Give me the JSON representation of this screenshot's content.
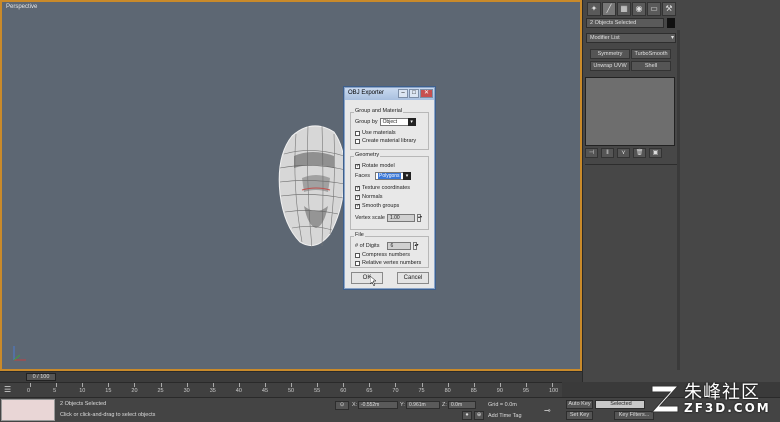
{
  "viewport": {
    "label": "Perspective"
  },
  "dialog": {
    "title": "OBJ Exporter",
    "group_material": {
      "title": "Group and Material",
      "group_by_label": "Group by",
      "group_by_value": "Object",
      "use_materials": "Use materials",
      "create_library": "Create material library"
    },
    "geometry": {
      "title": "Geometry",
      "flip_yz": "Rotate model",
      "faces_label": "Faces",
      "faces_value": "Polygons",
      "texture_coords": "Texture coordinates",
      "normals": "Normals",
      "smooth_groups": "Smooth groups",
      "vertex_scale_label": "Vertex scale",
      "vertex_scale_value": "1.00"
    },
    "file": {
      "title": "File",
      "digits_label": "# of Digits",
      "digits_value": "6",
      "compress": "Compress numbers",
      "relative": "Relative vertex numbers"
    },
    "ok": "OK",
    "cancel": "Cancel"
  },
  "command_panel": {
    "selection": "2 Objects Selected",
    "modifier_list": "Modifier List",
    "buttons": [
      "Symmetry",
      "TurboSmooth",
      "Unwrap UVW",
      "Shell"
    ]
  },
  "timeline": {
    "frame": "0 / 100",
    "ticks": [
      "0",
      "5",
      "10",
      "15",
      "20",
      "25",
      "30",
      "35",
      "40",
      "45",
      "50",
      "55",
      "60",
      "65",
      "70",
      "75",
      "80",
      "85",
      "90",
      "95",
      "100"
    ]
  },
  "status": {
    "selected": "2 Objects Selected",
    "prompt": "Click or click-and-drag to select objects",
    "x": "-0.552m",
    "y": "0.961m",
    "z": "0.0m",
    "grid": "Grid = 0.0m",
    "add_time_tag": "Add Time Tag",
    "auto_key": "Auto Key",
    "set_key": "Set Key",
    "selected_dropdown": "Selected",
    "key_filters": "Key Filters..."
  },
  "watermark": {
    "title": "朱峰社区",
    "subtitle": "ZF3D.COM"
  },
  "colors": {
    "viewport_bg": "#5d6773",
    "active_border": "#c98a2a",
    "panel_bg": "#474747",
    "dialog_bg": "#e8e8e8"
  }
}
